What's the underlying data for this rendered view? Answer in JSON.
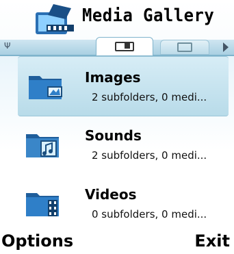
{
  "app": {
    "title": "Media Gallery"
  },
  "tabs": [
    {
      "icon": "gallery-list-icon",
      "active": true
    },
    {
      "icon": "gallery-grid-icon",
      "active": false
    }
  ],
  "folders": [
    {
      "name": "Images",
      "detail": "2 subfolders, 0 medi...",
      "icon": "image-folder-icon",
      "selected": true
    },
    {
      "name": "Sounds",
      "detail": "2 subfolders, 0 medi...",
      "icon": "sound-folder-icon",
      "selected": false
    },
    {
      "name": "Videos",
      "detail": "0 subfolders, 0 medi...",
      "icon": "video-folder-icon",
      "selected": false
    }
  ],
  "softkeys": {
    "left": "Options",
    "right": "Exit"
  },
  "colors": {
    "accent": "#9bc6d8",
    "tab_bg": "#a9d0e2",
    "folder_blue": "#1e5f9e"
  }
}
